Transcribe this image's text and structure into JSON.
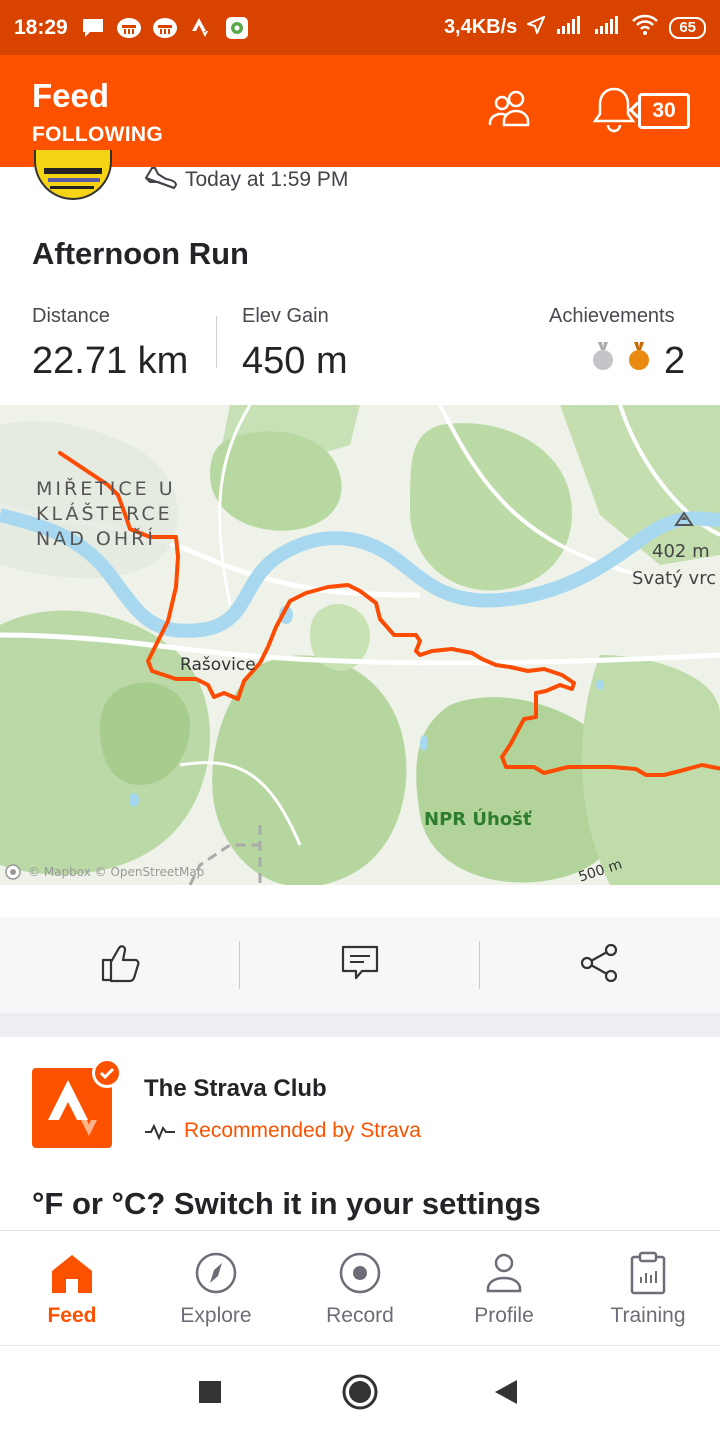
{
  "status_bar": {
    "time": "18:29",
    "network_speed": "3,4KB/s",
    "battery": "65",
    "icons": [
      "message-icon",
      "railway-app-icon",
      "railway-app-icon",
      "strava-icon",
      "app-icon",
      "location-icon",
      "signal-icon",
      "signal-icon",
      "wifi-icon",
      "battery-icon"
    ]
  },
  "header": {
    "title": "Feed",
    "subtitle": "FOLLOWING",
    "notification_count": "30"
  },
  "activity": {
    "timestamp": "Today at 1:59 PM",
    "title": "Afternoon Run",
    "distance_label": "Distance",
    "distance_value": "22.71 km",
    "elev_label": "Elev Gain",
    "elev_value": "450 m",
    "achievements_label": "Achievements",
    "achievements_count": "2",
    "map": {
      "places": {
        "town_line1": "MIŘETICE U",
        "town_line2": "KLÁŠTERCE",
        "town_line3": "NAD OHŘÍ",
        "village": "Rašovice",
        "reserve": "NPR Úhošť",
        "peak_elev": "402 m",
        "peak_name": "Svatý vrc"
      },
      "attribution": "© Mapbox © OpenStreetMap",
      "scale": "500 m"
    }
  },
  "actions": {
    "icons": [
      "thumbs-up-icon",
      "comment-icon",
      "share-icon"
    ]
  },
  "club": {
    "name": "The Strava Club",
    "recommended": "Recommended by Strava",
    "post_title": "°F or °C? Switch it in your settings"
  },
  "bottom_nav": {
    "items": [
      {
        "label": "Feed"
      },
      {
        "label": "Explore"
      },
      {
        "label": "Record"
      },
      {
        "label": "Profile"
      },
      {
        "label": "Training"
      }
    ]
  },
  "colors": {
    "brand": "#fc5200",
    "status_bar": "#d84300",
    "river": "#a8d8f0",
    "forest": "#b9d9a6",
    "route": "#fc4c02"
  }
}
